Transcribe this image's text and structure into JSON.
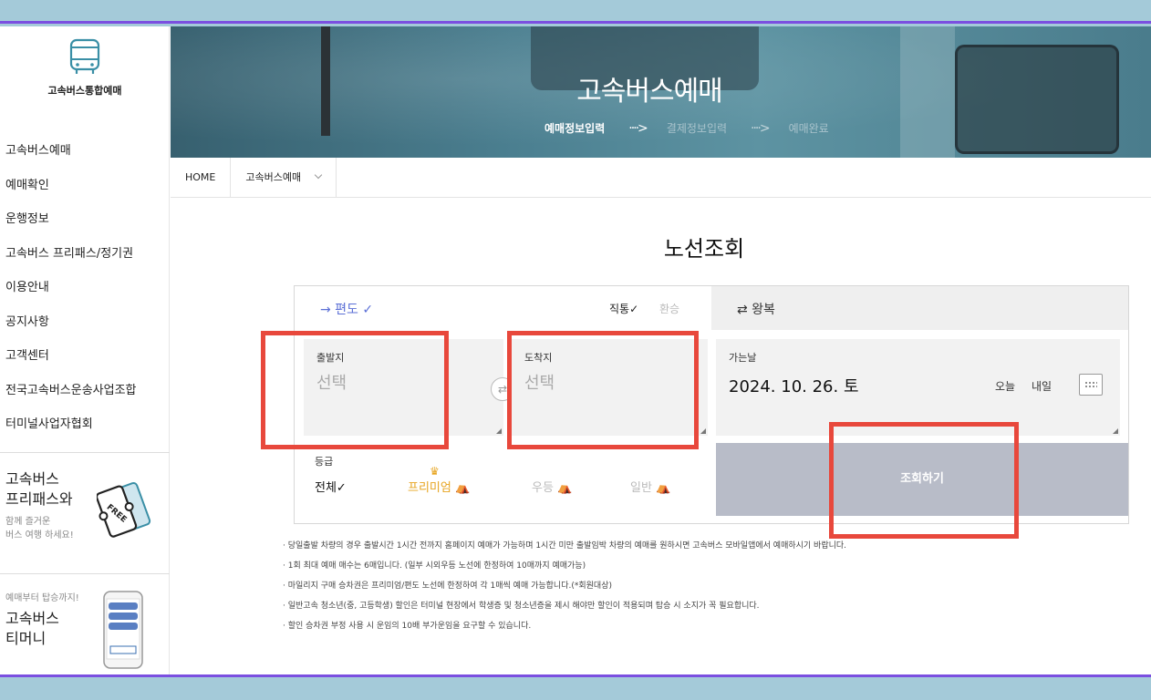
{
  "colors": {
    "frame": "#a4cad9",
    "frame_border": "#7b4fe0",
    "highlight": "#e8483c",
    "accent": "#5b6fd6",
    "premium": "#e7a41f",
    "search_button": "#b8bcc8"
  },
  "sidebar": {
    "logo_text": "고속버스통합예매",
    "items": [
      {
        "label": "고속버스예매"
      },
      {
        "label": "예매확인"
      },
      {
        "label": "운행정보"
      },
      {
        "label": "고속버스 프리패스/정기권"
      },
      {
        "label": "이용안내"
      },
      {
        "label": "공지사항"
      },
      {
        "label": "고객센터"
      },
      {
        "label": "전국고속버스운송사업조합"
      },
      {
        "label": "터미널사업자협회"
      }
    ],
    "promo_freepass": {
      "title_line1": "고속버스",
      "title_line2": "프리패스와",
      "sub_line1": "함께 즐거운",
      "sub_line2": "버스 여행 하세요!",
      "icon": "free-pass-ticket-icon"
    },
    "promo_tmoney": {
      "sub": "예매부터 탑승까지!",
      "title_line1": "고속버스",
      "title_line2": "티머니",
      "icon": "smartphone-app-icon"
    }
  },
  "banner": {
    "title": "고속버스예매",
    "steps": [
      {
        "label": "예매정보입력",
        "active": true
      },
      {
        "label": "결제정보입력",
        "active": false
      },
      {
        "label": "예매완료",
        "active": false
      }
    ],
    "arrow": "····>"
  },
  "breadcrumb": {
    "home": "HOME",
    "current": "고속버스예매"
  },
  "page_title": "노선조회",
  "tabs": {
    "oneway": "→ 편도 ✓",
    "direct": "직통✓",
    "transfer": "환승",
    "roundtrip": "⇄ 왕복"
  },
  "departure": {
    "label": "출발지",
    "value": "선택"
  },
  "arrival": {
    "label": "도착지",
    "value": "선택"
  },
  "swap_icon": "⇄",
  "date": {
    "label": "가는날",
    "value": "2024. 10. 26. 토",
    "today": "오늘",
    "tomorrow": "내일"
  },
  "grade": {
    "label": "등급",
    "options": [
      {
        "label": "전체✓"
      },
      {
        "label": "프리미엄 ⛺"
      },
      {
        "label": "우등 ⛺"
      },
      {
        "label": "일반 ⛺"
      }
    ],
    "crown": "♛"
  },
  "search_button": "조회하기",
  "notes": [
    "당일출발 차량의 경우 출발시간 1시간 전까지 홈페이지 예매가 가능하며 1시간 미만 출발임박 차량의 예매를 원하시면 고속버스 모바일앱에서 예매하시기 바랍니다.",
    "1회 최대 예매 매수는 6매입니다. (일부 시외우등 노선에 한정하여 10매까지 예매가능)",
    "마일리지 구매 승차권은 프리미엄/편도 노선에 한정하여 각 1매씩 예매 가능합니다.(*회원대상)",
    "일반고속 청소년(중, 고등학생) 할인은 터미널 현장에서 학생증 및 청소년증을 제시 해야만 할인이 적용되며 탑승 시 소지가 꼭 필요합니다.",
    "할인 승차권 부정 사용 시 운임의 10배 부가운임을 요구할 수 있습니다."
  ]
}
